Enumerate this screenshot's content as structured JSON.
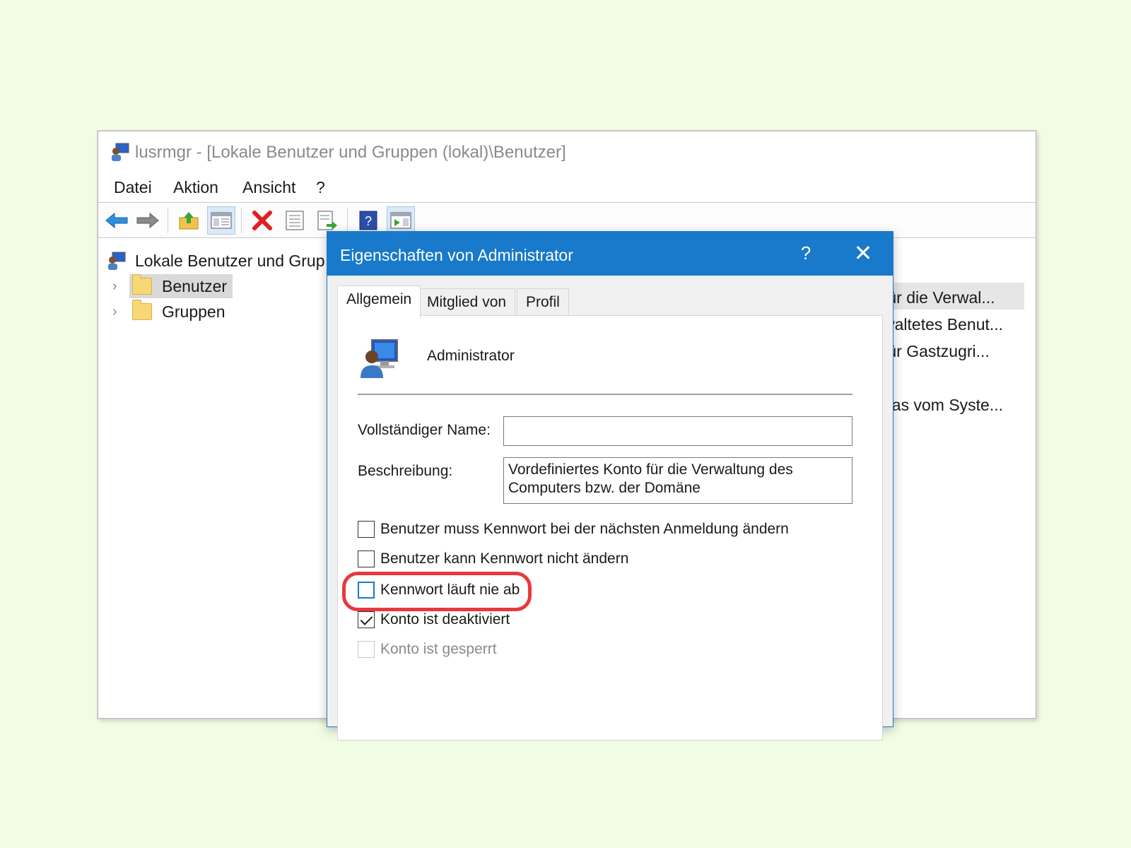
{
  "app": {
    "title": "lusrmgr - [Lokale Benutzer und Gruppen (lokal)\\Benutzer]"
  },
  "menu": [
    "Datei",
    "Aktion",
    "Ansicht",
    "?"
  ],
  "toolbar": {
    "icons": [
      "back-arrow-icon",
      "forward-arrow-icon",
      "up-folder-icon",
      "show-hide-console-tree-icon",
      "delete-icon",
      "properties-icon",
      "export-list-icon",
      "help-icon",
      "action-pane-icon"
    ]
  },
  "tree": {
    "root": "Lokale Benutzer und Grup",
    "items": [
      "Benutzer",
      "Gruppen"
    ]
  },
  "list": {
    "descriptions": [
      "für die Verwal...",
      "waltetes Benut...",
      "für Gastzugri...",
      "das vom Syste..."
    ]
  },
  "dialog": {
    "title": "Eigenschaften von Administrator",
    "help": "?",
    "tabs": [
      "Allgemein",
      "Mitglied von",
      "Profil"
    ],
    "user_name": "Administrator",
    "full_name_label": "Vollständiger Name:",
    "full_name_value": "",
    "description_label": "Beschreibung:",
    "description_line1": "Vordefiniertes Konto für die Verwaltung des",
    "description_line2": "Computers bzw. der Domäne",
    "checkboxes": [
      {
        "label": "Benutzer muss Kennwort bei der nächsten Anmeldung ändern",
        "checked": false,
        "enabled": true
      },
      {
        "label": "Benutzer kann Kennwort nicht ändern",
        "checked": false,
        "enabled": true
      },
      {
        "label": "Kennwort läuft nie ab",
        "checked": false,
        "enabled": true
      },
      {
        "label": "Konto ist deaktiviert",
        "checked": true,
        "enabled": true
      },
      {
        "label": "Konto ist gesperrt",
        "checked": false,
        "enabled": false
      }
    ]
  },
  "colors": {
    "background": "#f1fce4",
    "dialog_title_bar": "#1979ca",
    "highlight_ring": "#e8383c"
  }
}
